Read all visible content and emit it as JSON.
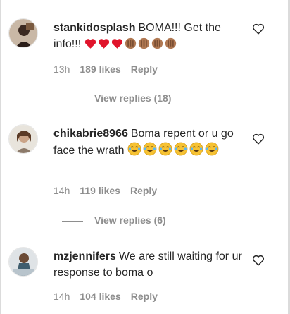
{
  "comments": [
    {
      "username": "stankidosplash",
      "text": "BOMA!!! Get the info!!!",
      "emojis": [
        "red-heart",
        "red-heart",
        "red-heart",
        "clap-tan",
        "clap-tan",
        "clap-tan",
        "clap-tan"
      ],
      "time": "13h",
      "likes": "189 likes",
      "reply": "Reply",
      "view_replies": "View replies (18)"
    },
    {
      "username": "chikabrie8966",
      "text": "Boma repent or u go face the wrath",
      "emojis": [
        "joy-face",
        "joy-face",
        "joy-face",
        "joy-face",
        "joy-face",
        "joy-face"
      ],
      "time": "14h",
      "likes": "119 likes",
      "reply": "Reply",
      "view_replies": "View replies (6)"
    },
    {
      "username": "mzjennifers",
      "text": "We are still waiting for ur response to boma o",
      "emojis": [],
      "time": "14h",
      "likes": "104 likes",
      "reply": "Reply"
    }
  ],
  "colors": {
    "text": "#262626",
    "muted": "#8e8e8e",
    "heart_red": "#e0142b",
    "clap": "#b07852",
    "joy": "#f6c233"
  }
}
